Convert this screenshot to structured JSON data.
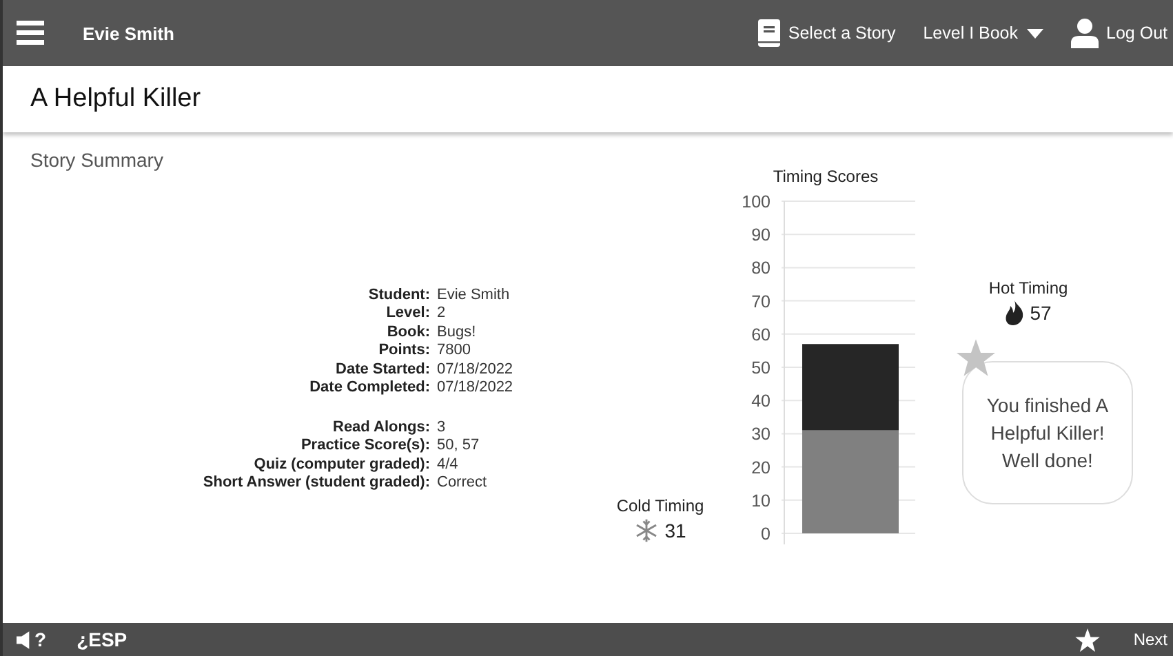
{
  "header": {
    "user_name": "Evie Smith",
    "select_story": "Select a Story",
    "level_menu": "Level I Book",
    "log_out": "Log Out"
  },
  "title": "A Helpful Killer",
  "section_title": "Story Summary",
  "details": [
    {
      "label": "Student:",
      "value": "Evie Smith"
    },
    {
      "label": "Level:",
      "value": "2"
    },
    {
      "label": "Book:",
      "value": "Bugs!"
    },
    {
      "label": "Points:",
      "value": "7800"
    },
    {
      "label": "Date Started:",
      "value": "07/18/2022"
    },
    {
      "label": "Date Completed:",
      "value": "07/18/2022"
    }
  ],
  "details_2": [
    {
      "label": "Read Alongs:",
      "value": "3"
    },
    {
      "label": "Practice Score(s):",
      "value": "50, 57"
    },
    {
      "label": "Quiz (computer graded):",
      "value": "4/4"
    },
    {
      "label": "Short Answer (student graded):",
      "value": "Correct"
    }
  ],
  "cold_timing": {
    "value": "31"
  },
  "hot_timing": {
    "value": "57"
  },
  "chart_data": {
    "type": "bar",
    "title": "Timing Scores",
    "categories": [
      null
    ],
    "stacked": true,
    "grid": true,
    "ylim": [
      0,
      100
    ],
    "yticks": [
      0,
      10,
      20,
      30,
      40,
      50,
      60,
      70,
      80,
      90,
      100
    ],
    "series": [
      {
        "name": "Cold Timing",
        "color": "#808080",
        "values": [
          31
        ]
      },
      {
        "name": "Hot Timing",
        "color": "#262626",
        "values": [
          26
        ]
      }
    ]
  },
  "message": "You finished A Helpful Killer! Well done!",
  "footer": {
    "help": "?",
    "language": "¿ESP",
    "next": "Next"
  }
}
